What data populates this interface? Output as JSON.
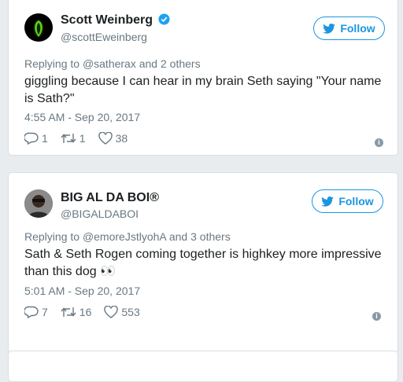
{
  "tweets": [
    {
      "display_name": "Scott Weinberg",
      "handle": "@scottEweinberg",
      "verified": true,
      "follow_label": "Follow",
      "reply_prefix": "Replying to",
      "reply_mentions": "@satherax and 2 others",
      "text": "giggling because I can hear in my brain Seth saying \"Your name is Sath?\"",
      "timestamp": "4:55 AM - Sep 20, 2017",
      "replies": "1",
      "retweets": "1",
      "likes": "38"
    },
    {
      "display_name": "BIG AL DA BOI®",
      "handle": "@BIGALDABOI",
      "verified": false,
      "follow_label": "Follow",
      "reply_prefix": "Replying to",
      "reply_mentions": "@emoreJstlyohA and 3 others",
      "text": "Sath & Seth Rogen coming together is highkey more impressive than this dog 👀",
      "timestamp": "5:01 AM - Sep 20, 2017",
      "replies": "7",
      "retweets": "16",
      "likes": "553"
    }
  ],
  "colors": {
    "accent": "#1b95e0",
    "muted": "#697882",
    "text": "#1c2022",
    "background": "#e9ecef"
  },
  "icons": [
    "verified-badge-icon",
    "twitter-bird-icon",
    "reply-icon",
    "retweet-icon",
    "heart-icon",
    "info-icon"
  ]
}
